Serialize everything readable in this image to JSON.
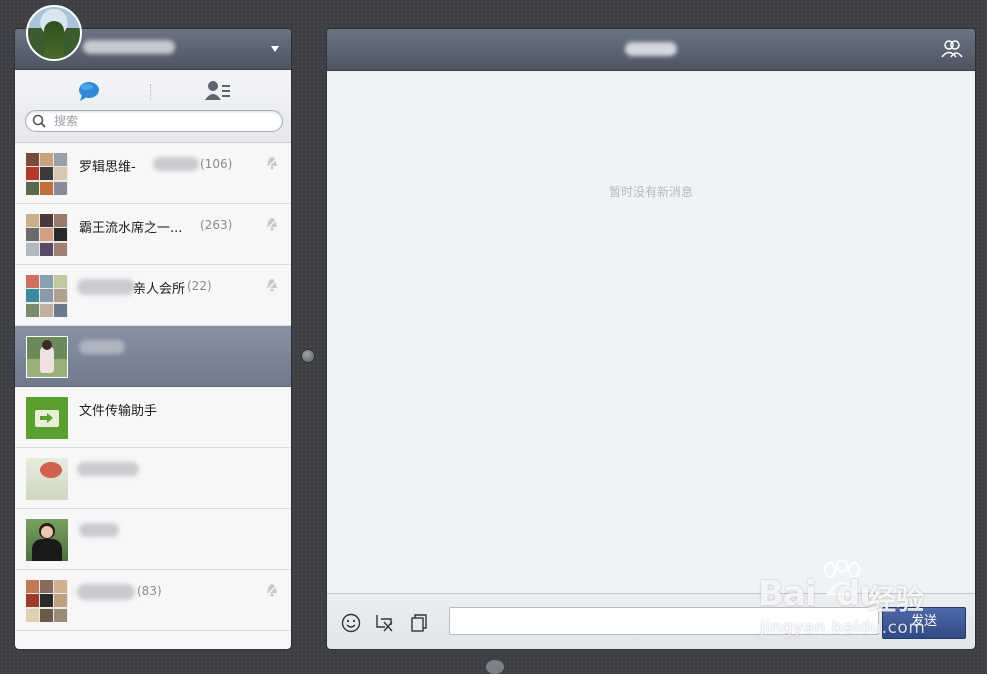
{
  "search": {
    "placeholder": "搜索"
  },
  "chats": [
    {
      "name": "罗辑思维-",
      "count": "(106)",
      "muted": true
    },
    {
      "name": "霸王流水席之一...",
      "count": "(263)",
      "muted": true
    },
    {
      "name": "亲人会所",
      "count": "(22)",
      "muted": true
    },
    {
      "name": "",
      "count": "",
      "muted": false,
      "selected": true
    },
    {
      "name": "文件传输助手",
      "count": "",
      "muted": false
    },
    {
      "name": "",
      "count": "",
      "muted": false
    },
    {
      "name": "",
      "count": "",
      "muted": false
    },
    {
      "name": "",
      "count": "(83)",
      "muted": true
    }
  ],
  "conversation": {
    "empty_message": "暂时没有新消息"
  },
  "compose": {
    "send_label": "发送"
  },
  "watermark": {
    "logo": "Bai",
    "logo_suffix": "du",
    "product": "经验",
    "url": "jingyan.baidu.com"
  },
  "colors": {
    "header": "#5b6370",
    "selected_row": "#7d8798",
    "send_button": "#3d5796",
    "page_bg": "#3d3f44"
  }
}
